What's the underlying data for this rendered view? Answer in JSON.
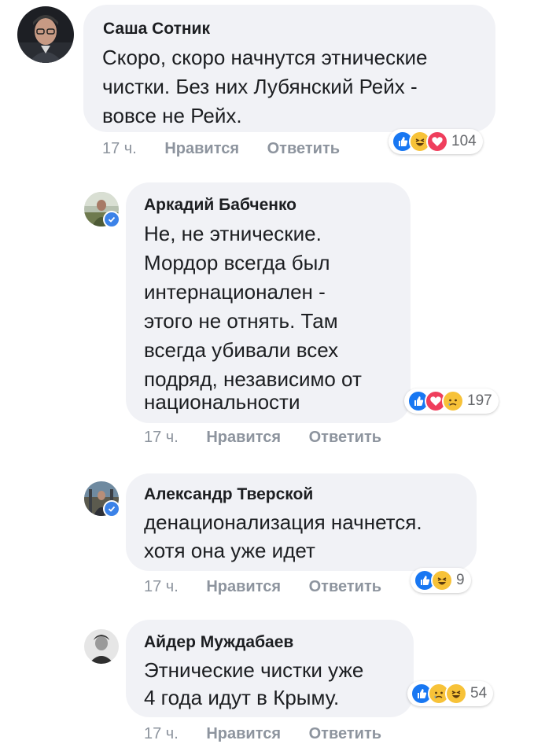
{
  "comments": [
    {
      "author": "Саша Сотник",
      "lines": [
        "Скоро, скоро начнутся этнические",
        "чистки. Без них Лубянский Рейх -",
        "вовсе не Рейх."
      ],
      "time": "17 ч.",
      "like_label": "Нравится",
      "reply_label": "Ответить",
      "reactions": [
        "like",
        "haha",
        "love"
      ],
      "reaction_count": "104",
      "verified": false
    },
    {
      "author": "Аркадий Бабченко",
      "lines": [
        "Не, не этнические.",
        "Мордор всегда был",
        "интернационален -",
        "этого не отнять. Там",
        "всегда убивали всех",
        "подряд, независимо от",
        "национальности"
      ],
      "time": "17 ч.",
      "like_label": "Нравится",
      "reply_label": "Ответить",
      "reactions": [
        "like",
        "love",
        "sad"
      ],
      "reaction_count": "197",
      "verified": true
    },
    {
      "author": "Александр Тверской",
      "lines": [
        "денационализация начнется.",
        "хотя она уже идет"
      ],
      "time": "17 ч.",
      "like_label": "Нравится",
      "reply_label": "Ответить",
      "reactions": [
        "like",
        "haha"
      ],
      "reaction_count": "9",
      "verified": true
    },
    {
      "author": "Айдер Муждабаев",
      "lines": [
        "Этнические чистки уже",
        "4 года идут в Крыму."
      ],
      "time": "17 ч.",
      "like_label": "Нравится",
      "reply_label": "Ответить",
      "reactions": [
        "like",
        "sad",
        "haha"
      ],
      "reaction_count": "54",
      "verified": false
    }
  ],
  "colors": {
    "bubble": "#f1f2f6",
    "meta": "#8d949e",
    "like": "#1877f2",
    "love": "#ef3e5c",
    "emoji": "#f7c238",
    "verified": "#3b82e8"
  }
}
